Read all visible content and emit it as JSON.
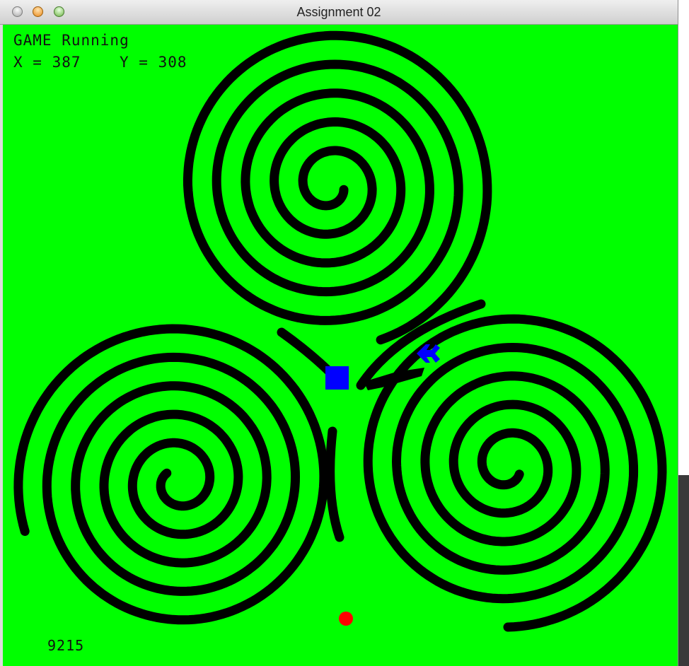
{
  "window": {
    "title": "Assignment 02"
  },
  "hud": {
    "status": "GAME Running",
    "x_label": "X = 387",
    "y_label": "Y = 308",
    "score": "9215"
  },
  "game": {
    "player_shape": "square",
    "enemy_shape": "arrow",
    "goal_shape": "circle",
    "colors": {
      "field": "#00ff00",
      "walls": "#000000",
      "player": "#0000ff",
      "enemy": "#0000ff",
      "goal": "#ff0000"
    }
  }
}
